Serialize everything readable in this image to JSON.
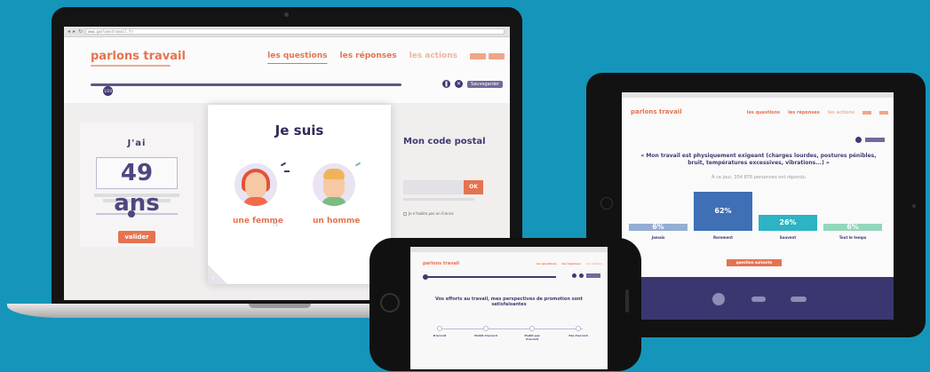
{
  "laptop": {
    "url": "www.parlonstravail.fr",
    "logo": "parlons travail",
    "nav": {
      "questions": "les questions",
      "answers": "les réponses",
      "actions": "les actions"
    },
    "save_label": "Sauvegarder",
    "progress_dot": "1/20",
    "left_panel": {
      "title": "J'ai",
      "age": "49 ans",
      "validate": "valider"
    },
    "card": {
      "title": "Je suis",
      "female": "une femme",
      "male": "un homme"
    },
    "right_panel": {
      "title": "Mon code postal",
      "ok": "OK",
      "abroad": "Je n'habite pas en France"
    }
  },
  "tablet": {
    "logo": "parlons travail",
    "nav": {
      "questions": "les questions",
      "answers": "les réponses",
      "actions": "les actions"
    },
    "question": "« Mon travail est physiquement exigeant (charges lourdes, postures pénibles, bruit, températures excessives, vibrations...) »",
    "subtitle": "À ce jour, 354 876 personnes ont répondu",
    "bars": [
      {
        "label": "Jamais",
        "value": "6%",
        "pct": 6,
        "color": "#3f6fb5"
      },
      {
        "label": "Rarement",
        "value": "62%",
        "pct": 62,
        "color": "#3f6fb5"
      },
      {
        "label": "Souvent",
        "value": "26%",
        "pct": 26,
        "color": "#2cb3c4"
      },
      {
        "label": "Tout le temps",
        "value": "6%",
        "pct": 6,
        "color": "#3fb98a"
      }
    ],
    "next_label": "question suivante"
  },
  "phone": {
    "logo": "parlons travail",
    "nav": {
      "questions": "les questions",
      "answers": "les réponses",
      "actions": "les actions"
    },
    "question": "Vos efforts au travail, mes perspectives de promotion sont satisfaisantes",
    "scale": [
      "D'accord",
      "Plutôt d'accord",
      "Plutôt pas d'accord",
      "Pas d'accord"
    ]
  },
  "colors": {
    "background": "#1595b9",
    "accent": "#e57350",
    "navy": "#3f3a70"
  }
}
